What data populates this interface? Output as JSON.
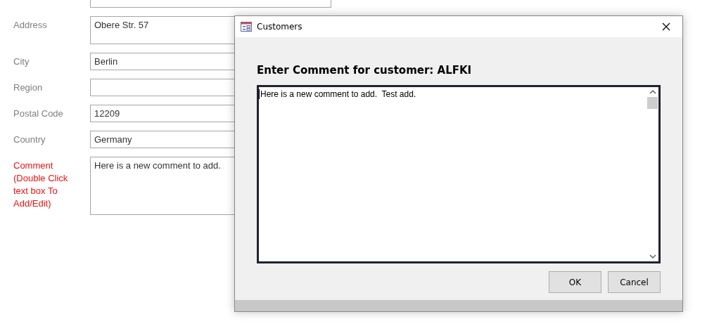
{
  "form": {
    "fields": [
      {
        "kind": "line"
      },
      {
        "label": "Address",
        "value": "Obere Str. 57",
        "kind": "tall",
        "color": "#7f7f7f"
      },
      {
        "label": "City",
        "value": "Berlin",
        "kind": "line",
        "color": "#7f7f7f"
      },
      {
        "label": "Region",
        "kind": "line",
        "color": "#7f7f7f"
      },
      {
        "label": "Postal Code",
        "value": "12209",
        "kind": "line",
        "color": "#7f7f7f"
      },
      {
        "label": "Country",
        "value": "Germany",
        "kind": "line",
        "color": "#7f7f7f"
      },
      {
        "label": "Comment (Double Click text box To Add/Edit)",
        "value": "Here is a new comment to add.",
        "kind": "memo",
        "color": "#ee1111"
      }
    ]
  },
  "dialog": {
    "title": "Customers",
    "heading": "Enter Comment for customer: ALFKI",
    "comment": "Here is a new comment to add.  Test add.",
    "buttons": [
      "OK",
      "Cancel"
    ]
  }
}
